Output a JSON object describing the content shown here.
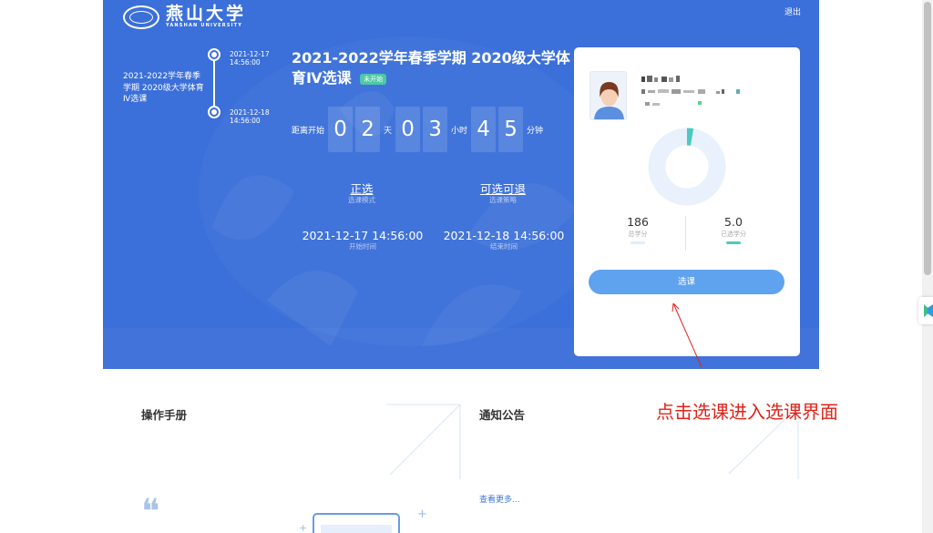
{
  "header": {
    "logo_cn": "燕山大学",
    "logo_en": "YANSHAN UNIVERSITY",
    "logout": "退出"
  },
  "timeline": {
    "course": "2021-2022学年春季学期 2020级大学体育Ⅳ选课",
    "start_date": "2021-12-17",
    "start_time": "14:56:00",
    "end_date": "2021-12-18",
    "end_time": "14:56:00"
  },
  "course": {
    "title": "2021-2022学年春季学期 2020级大学体育Ⅳ选课",
    "status": "未开始"
  },
  "countdown": {
    "prefix": "距离开始",
    "days": [
      "0",
      "2"
    ],
    "day_unit": "天",
    "hours": [
      "0",
      "3"
    ],
    "hour_unit": "小时",
    "minutes": [
      "4",
      "5"
    ],
    "minute_unit": "分钟"
  },
  "info": {
    "mode_value": "正选",
    "mode_label": "选课模式",
    "strategy_value": "可选可退",
    "strategy_label": "选课策略",
    "start_value": "2021-12-17 14:56:00",
    "start_label": "开始时间",
    "end_value": "2021-12-18 14:56:00",
    "end_label": "结束时间"
  },
  "panel": {
    "total_credits": "186",
    "total_label": "总学分",
    "selected_credits": "5.0",
    "selected_label": "已选学分",
    "selected_fraction": 0.027,
    "select_button": "选课",
    "colors": {
      "ring_bg": "#e8f1fc",
      "ring_fill": "#4dc9c0",
      "button": "#5fa2ee"
    }
  },
  "lower": {
    "manual_title": "操作手册",
    "notice_title": "通知公告",
    "more": "查看更多..."
  },
  "annotation": "点击选课进入选课界面",
  "colors": {
    "hero_bg": "#3b6fd9",
    "badge": "#4dc9a6",
    "annotation": "#e0231b"
  }
}
